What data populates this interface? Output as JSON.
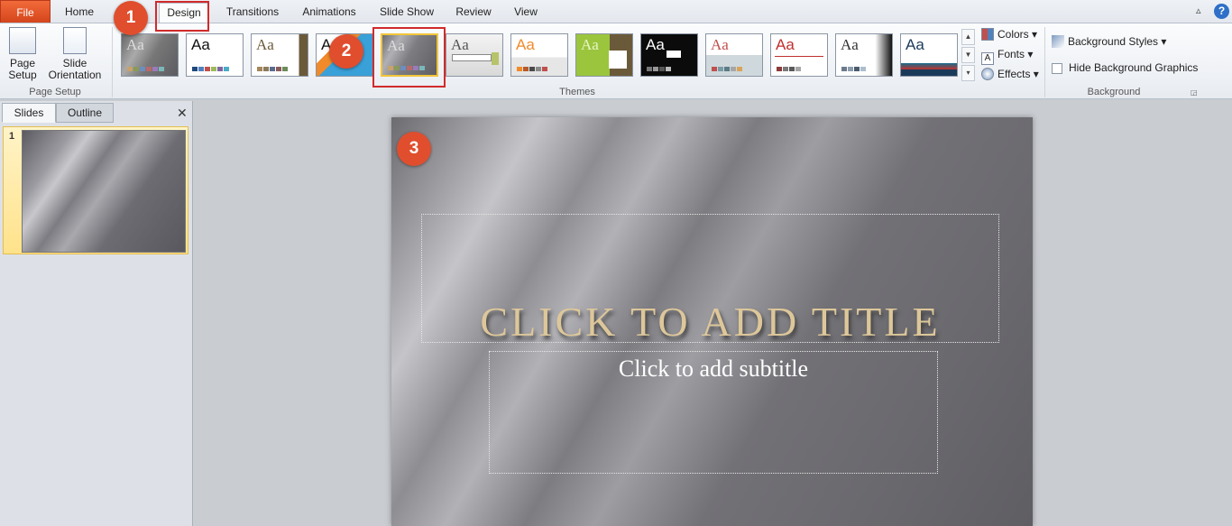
{
  "tabs": [
    "File",
    "Home",
    "Design",
    "Transitions",
    "Animations",
    "Slide Show",
    "Review",
    "View"
  ],
  "page_setup": {
    "page_setup_label": "Page Setup",
    "slide_orientation_label": "Slide Orientation",
    "group_label": "Page Setup"
  },
  "themes": {
    "group_label": "Themes",
    "sample_text": "Aa"
  },
  "theme_side": {
    "colors": "Colors",
    "fonts": "Fonts",
    "effects": "Effects"
  },
  "background": {
    "styles": "Background Styles",
    "hide_graphics": "Hide Background Graphics",
    "group_label": "Background"
  },
  "left_pane": {
    "tabs": [
      "Slides",
      "Outline"
    ],
    "slide_number": "1"
  },
  "slide": {
    "title": "CLICK TO ADD TITLE",
    "subtitle": "Click to add subtitle"
  },
  "badges": [
    "1",
    "2",
    "3"
  ],
  "colors": {
    "file_tab": "#e04e2e",
    "highlight": "#d12b2b"
  }
}
